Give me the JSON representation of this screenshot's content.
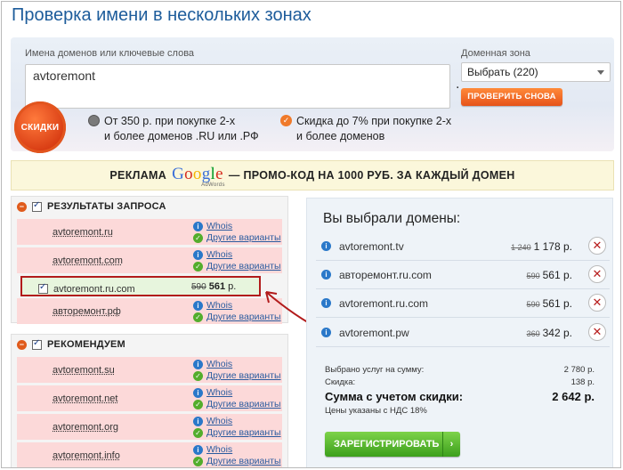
{
  "page": {
    "title": "Проверка имени в нескольких зонах"
  },
  "search": {
    "label": "Имена доменов или ключевые слова",
    "value": "avtoremont",
    "zone_label": "Доменная зона",
    "zone_value": "Выбрать (220)",
    "check_button": "ПРОВЕРИТЬ СНОВА",
    "badge": "СКИДКИ",
    "offers": [
      {
        "line1": "От 350 р. при покупке 2-х",
        "line2": "и более доменов .RU или .РФ",
        "icon": "radio-icon"
      },
      {
        "line1": "Скидка до 7% при покупке 2-х",
        "line2": "и более доменов",
        "icon": "check-icon"
      }
    ]
  },
  "ad": {
    "prefix": "РЕКЛАМА",
    "logo": "Google",
    "logo_sub": "AdWords",
    "text": "— ПРОМО-КОД НА 1000 РУБ. ЗА КАЖДЫЙ ДОМЕН"
  },
  "results": {
    "title": "РЕЗУЛЬТАТЫ ЗАПРОСА",
    "items": [
      {
        "name": "avtoremont.ru",
        "whois": "Whois",
        "other": "Другие варианты"
      },
      {
        "name": "avtoremont.com",
        "whois": "Whois",
        "other": "Другие варианты"
      },
      {
        "name": "avtoremont.ru.com",
        "price_old": "590",
        "price_new": "561",
        "currency": "р."
      },
      {
        "name": "авторемонт.рф",
        "whois": "Whois",
        "other": "Другие варианты"
      }
    ]
  },
  "recommend": {
    "title": "РЕКОМЕНДУЕМ",
    "items": [
      {
        "name": "avtoremont.su",
        "whois": "Whois",
        "other": "Другие варианты"
      },
      {
        "name": "avtoremont.net",
        "whois": "Whois",
        "other": "Другие варианты"
      },
      {
        "name": "avtoremont.org",
        "whois": "Whois",
        "other": "Другие варианты"
      },
      {
        "name": "avtoremont.info",
        "whois": "Whois",
        "other": "Другие варианты"
      }
    ]
  },
  "cart": {
    "title": "Вы выбрали домены:",
    "items": [
      {
        "name": "avtoremont.tv",
        "old": "1 240",
        "price": "1 178 р."
      },
      {
        "name": "авторемонт.ru.com",
        "old": "590",
        "price": "561 р."
      },
      {
        "name": "avtoremont.ru.com",
        "old": "590",
        "price": "561 р."
      },
      {
        "name": "avtoremont.pw",
        "old": "360",
        "price": "342 р."
      }
    ],
    "subtotal_label": "Выбрано услуг на сумму:",
    "subtotal_value": "2 780 р.",
    "discount_label": "Скидка:",
    "discount_value": "138 р.",
    "total_label": "Сумма с учетом скидки:",
    "total_value": "2 642 р.",
    "vat_note": "Цены указаны с НДС 18%",
    "register_button": "ЗАРЕГИСТРИРОВАТЬ"
  },
  "colors": {
    "title": "#1d5c9b",
    "accent_orange": "#e6531a",
    "accent_green": "#3c9f1c",
    "row_unavailable": "#fcd9d9",
    "row_selected": "#e7f5dd",
    "highlight": "#b21b1b"
  }
}
